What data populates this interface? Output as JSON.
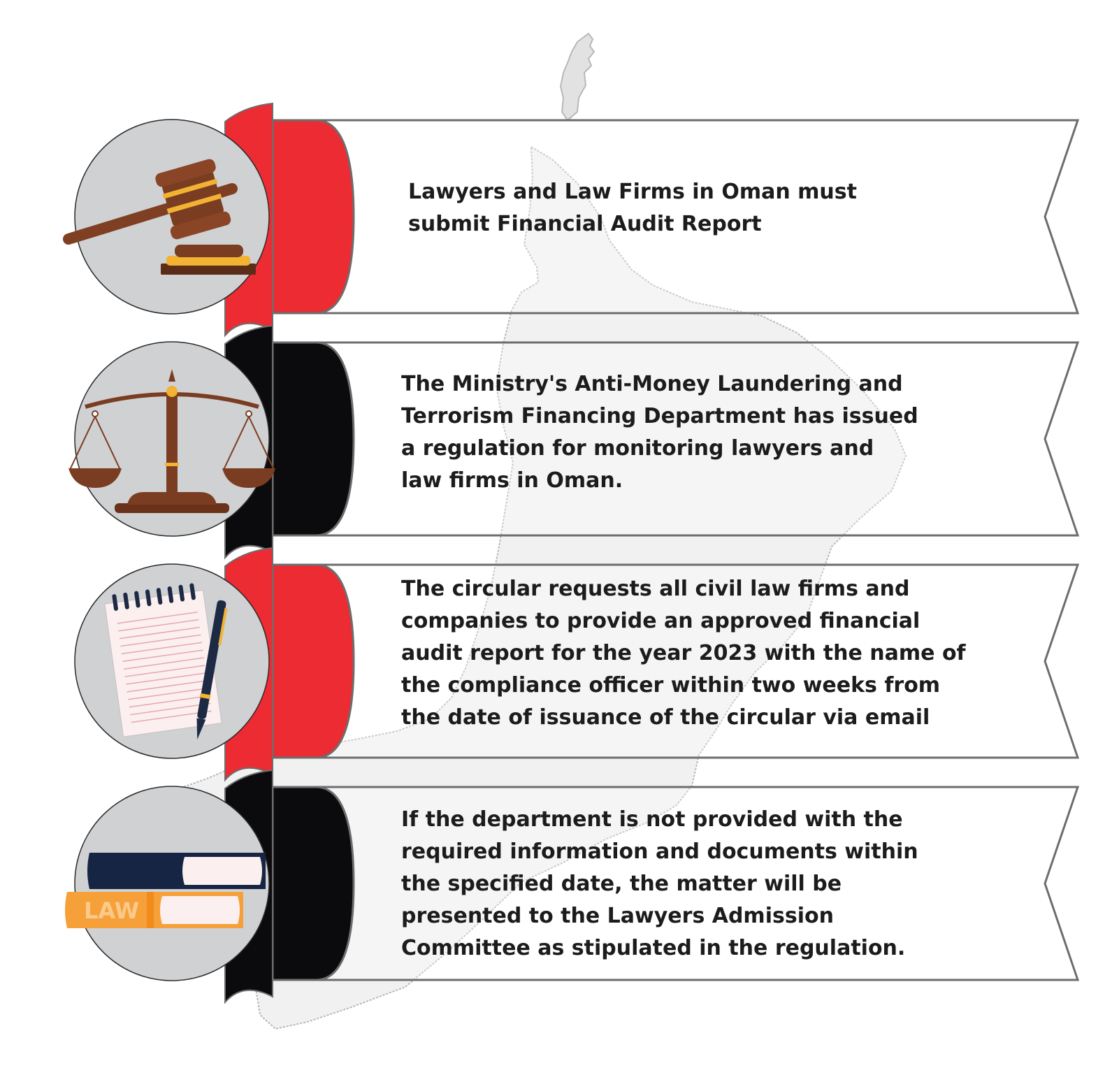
{
  "colors": {
    "red": "#ed2b32",
    "black": "#0b0b0d",
    "circle_fill": "#d0d1d3",
    "map_fill": "#f1f1f1",
    "map_stroke": "#b8b8b8",
    "outline": "#6d6d6d",
    "wood": "#7a3d22",
    "gold": "#f2b233"
  },
  "items": [
    {
      "accent": "red",
      "icon": "gavel-icon",
      "text": "Lawyers and Law Firms in Oman must\nsubmit  Financial Audit Report"
    },
    {
      "accent": "black",
      "icon": "scales-of-justice-icon",
      "text": "The Ministry's Anti-Money Laundering and\nTerrorism Financing Department has issued\na regulation for monitoring lawyers and\nlaw firms in Oman."
    },
    {
      "accent": "red",
      "icon": "notepad-and-pen-icon",
      "text": "The circular requests all civil law firms and\ncompanies to provide an approved financial\naudit report for the year 2023 with the name of\nthe compliance officer within two weeks from\nthe date of issuance of the circular via email"
    },
    {
      "accent": "black",
      "icon": "law-books-icon",
      "text": "If the department is not provided with the\nrequired information and documents within\nthe specified date, the matter will be\npresented to the Lawyers Admission\nCommittee as stipulated in the regulation."
    }
  ],
  "book_label": "LAW"
}
